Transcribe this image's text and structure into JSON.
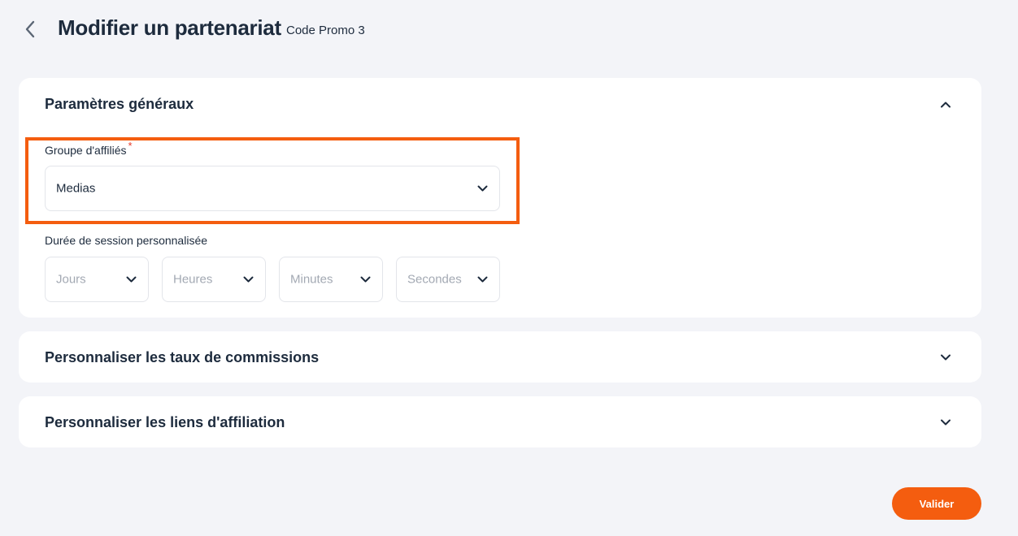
{
  "header": {
    "title": "Modifier un partenariat",
    "subtitle": "Code Promo 3",
    "back_icon": "chevron-left-icon"
  },
  "general_section": {
    "title": "Paramètres généraux",
    "expanded": true,
    "affiliate_group": {
      "label": "Groupe d'affiliés",
      "required_marker": "*",
      "value": "Medias"
    },
    "session_duration": {
      "label": "Durée de session personnalisée",
      "fields": [
        {
          "placeholder": "Jours"
        },
        {
          "placeholder": "Heures"
        },
        {
          "placeholder": "Minutes"
        },
        {
          "placeholder": "Secondes"
        }
      ]
    }
  },
  "commissions_section": {
    "title": "Personnaliser les taux de commissions",
    "expanded": false
  },
  "links_section": {
    "title": "Personnaliser les liens d'affiliation",
    "expanded": false
  },
  "actions": {
    "submit_label": "Valider"
  },
  "colors": {
    "accent": "#f45d0f",
    "background": "#f3f4f8",
    "card": "#ffffff",
    "text": "#1d2b3d",
    "placeholder": "#a3a9b3",
    "required": "#e5392b"
  }
}
